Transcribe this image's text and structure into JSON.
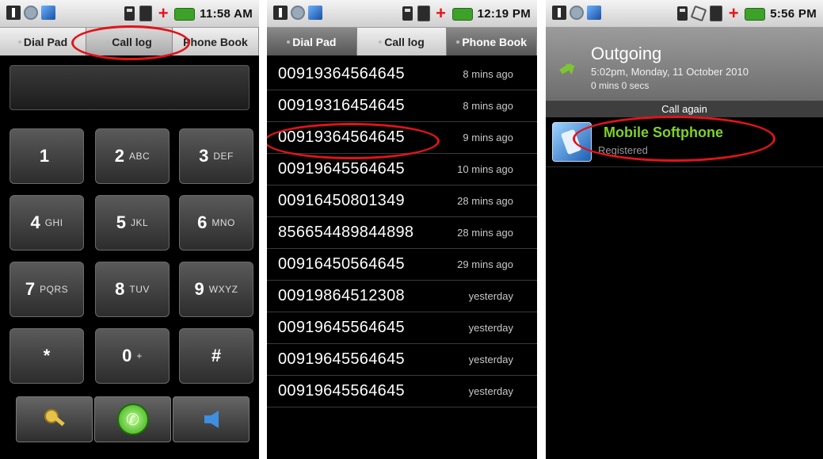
{
  "phone1": {
    "status_time": "11:58 AM",
    "tabs": [
      "Dial Pad",
      "Call log",
      "Phone Book"
    ],
    "keys": [
      {
        "digit": "1",
        "letters": ""
      },
      {
        "digit": "2",
        "letters": "ABC"
      },
      {
        "digit": "3",
        "letters": "DEF"
      },
      {
        "digit": "4",
        "letters": "GHI"
      },
      {
        "digit": "5",
        "letters": "JKL"
      },
      {
        "digit": "6",
        "letters": "MNO"
      },
      {
        "digit": "7",
        "letters": "PQRS"
      },
      {
        "digit": "8",
        "letters": "TUV"
      },
      {
        "digit": "9",
        "letters": "WXYZ"
      },
      {
        "digit": "*",
        "letters": ""
      },
      {
        "digit": "0",
        "letters": "+"
      },
      {
        "digit": "#",
        "letters": ""
      }
    ],
    "actions": [
      "key-icon",
      "call-icon",
      "back-arrow-icon"
    ]
  },
  "phone2": {
    "status_time": "12:19 PM",
    "tabs": [
      "Dial Pad",
      "Call log",
      "Phone Book"
    ],
    "calls": [
      {
        "number": "00919364564645",
        "when": "8 mins ago"
      },
      {
        "number": "00919316454645",
        "when": "8 mins ago"
      },
      {
        "number": "00919364564645",
        "when": "9 mins ago"
      },
      {
        "number": "00919645564645",
        "when": "10 mins ago"
      },
      {
        "number": "00916450801349",
        "when": "28 mins ago"
      },
      {
        "number": "856654489844898",
        "when": "28 mins ago"
      },
      {
        "number": "00916450564645",
        "when": "29 mins ago"
      },
      {
        "number": "00919864512308",
        "when": "yesterday"
      },
      {
        "number": "00919645564645",
        "when": "yesterday"
      },
      {
        "number": "00919645564645",
        "when": "yesterday"
      },
      {
        "number": "00919645564645",
        "when": "yesterday"
      }
    ]
  },
  "phone3": {
    "status_time": "5:56 PM",
    "title": "Outgoing",
    "datetime": "5:02pm, Monday, 11 October 2010",
    "duration": "0 mins 0 secs",
    "call_again": "Call again",
    "softphone_name": "Mobile Softphone",
    "softphone_status": "Registered"
  },
  "colors": {
    "annotation": "#e0141a",
    "softphone_green": "#7fd12b",
    "battery": "#3ea12a"
  }
}
